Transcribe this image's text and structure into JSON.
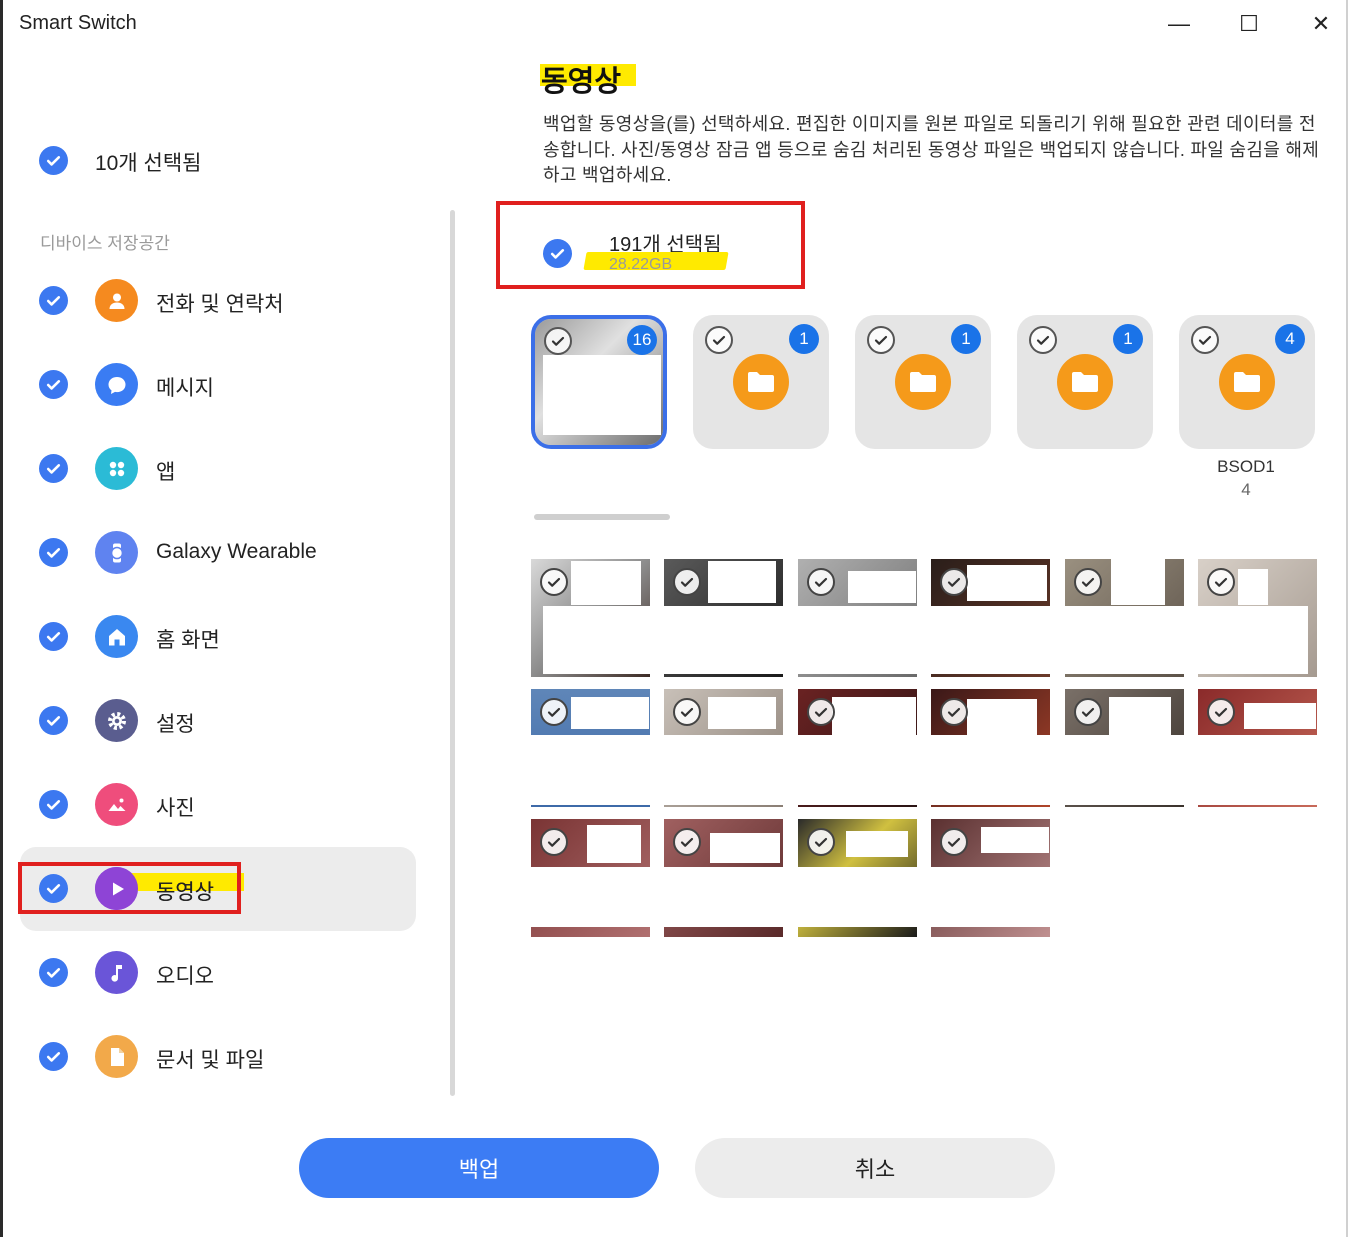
{
  "window": {
    "title": "Smart Switch",
    "minimize": "—",
    "maximize": "☐",
    "close": "✕",
    "cut_text": "- - - -  -  -  -  -"
  },
  "sidebar": {
    "selected_summary": "10개 선택됨",
    "storage_header": "디바이스 저장공간",
    "categories": [
      {
        "label": "전화 및 연락처",
        "icon": "contact-icon",
        "color": "#f58a1f"
      },
      {
        "label": "메시지",
        "icon": "message-icon",
        "color": "#3a7cf3"
      },
      {
        "label": "앱",
        "icon": "apps-icon",
        "color": "#2bbbd6"
      },
      {
        "label": "Galaxy Wearable",
        "icon": "watch-icon",
        "color": "#5f83f0"
      },
      {
        "label": "홈 화면",
        "icon": "home-icon",
        "color": "#3a88f0"
      },
      {
        "label": "설정",
        "icon": "settings-icon",
        "color": "#5a5d8f"
      },
      {
        "label": "사진",
        "icon": "photo-icon",
        "color": "#ef4d7c"
      },
      {
        "label": "동영상",
        "icon": "video-icon",
        "color": "#8e44d6"
      },
      {
        "label": "오디오",
        "icon": "audio-icon",
        "color": "#6a55d8"
      },
      {
        "label": "문서 및 파일",
        "icon": "document-icon",
        "color": "#f2a94a"
      }
    ],
    "active_index": 7
  },
  "main": {
    "title": "동영상",
    "description": "백업할 동영상을(를) 선택하세요. 편집한 이미지를 원본 파일로 되돌리기 위해 필요한 관련 데이터를 전송합니다. 사진/동영상 잠금 앱 등으로 숨김 처리된 동영상 파일은 백업되지 않습니다. 파일 숨김을 해제하고 백업하세요.",
    "selected_count": "191개 선택됨",
    "selected_size": "28.22GB",
    "albums": [
      {
        "badge": "16",
        "name": "",
        "count": ""
      },
      {
        "badge": "1",
        "name": "",
        "count": ""
      },
      {
        "badge": "1",
        "name": "",
        "count": ""
      },
      {
        "badge": "1",
        "name": "",
        "count": ""
      },
      {
        "badge": "4",
        "name": "BSOD1",
        "count": "4"
      }
    ]
  },
  "buttons": {
    "backup": "백업",
    "cancel": "취소"
  },
  "colors": {
    "accent": "#3c7cf4",
    "highlight": "#ffea00",
    "annotation_red": "#e0201e",
    "badge_blue": "#1a73e8",
    "folder_orange": "#f59a1a"
  }
}
